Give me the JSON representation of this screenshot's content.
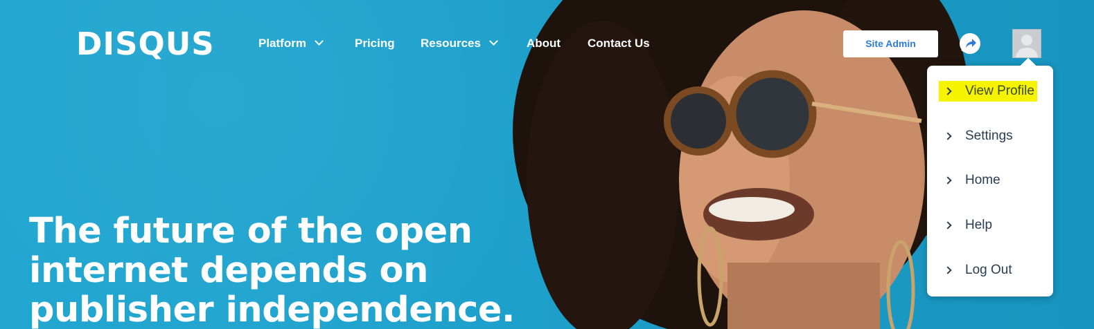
{
  "brand": {
    "logo_text": "DISQUS"
  },
  "nav": {
    "items": [
      {
        "label": "Platform",
        "has_dropdown": true
      },
      {
        "label": "Pricing",
        "has_dropdown": false
      },
      {
        "label": "Resources",
        "has_dropdown": true
      },
      {
        "label": "About",
        "has_dropdown": false
      },
      {
        "label": "Contact Us",
        "has_dropdown": false
      }
    ]
  },
  "header_actions": {
    "site_admin_label": "Site Admin",
    "notifications_icon": "share-arrow-icon",
    "avatar_icon": "default-avatar-icon"
  },
  "user_menu": {
    "items": [
      {
        "label": "View Profile",
        "highlighted": true
      },
      {
        "label": "Settings",
        "highlighted": false
      },
      {
        "label": "Home",
        "highlighted": false
      },
      {
        "label": "Help",
        "highlighted": false
      },
      {
        "label": "Log Out",
        "highlighted": false
      }
    ]
  },
  "hero": {
    "headline": "The future of the open internet depends on publisher independence."
  },
  "colors": {
    "background": "#1ea2cc",
    "site_admin_text": "#2e7bd6",
    "menu_text": "#2a3d52",
    "highlight": "#f6f300"
  }
}
